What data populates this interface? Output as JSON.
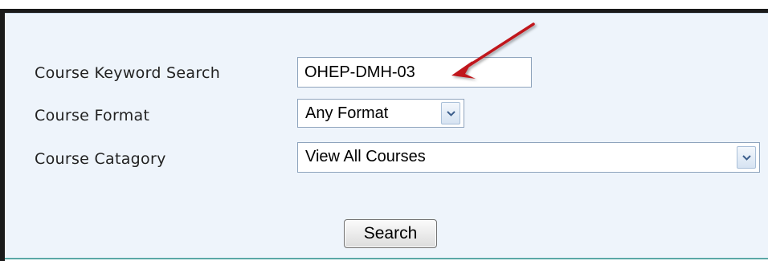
{
  "form": {
    "keyword": {
      "label": "Course Keyword Search",
      "value": "OHEP-DMH-03"
    },
    "format": {
      "label": "Course Format",
      "selected": "Any Format"
    },
    "category": {
      "label": "Course Catagory",
      "selected": "View All Courses"
    },
    "search_label": "Search"
  },
  "colors": {
    "panel_background": "#eef4fb",
    "frame_border": "#1a1a1a",
    "panel_bottom_rule": "#5aa8a6",
    "annotation_arrow": "#c0171b"
  },
  "icons": {
    "dropdown": "chevron-down-icon",
    "annotation": "red-arrow-icon"
  }
}
